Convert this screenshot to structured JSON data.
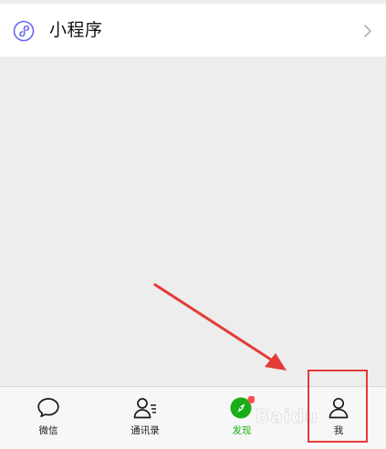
{
  "mini_programs": {
    "label": "小程序",
    "icon": "mini-program-icon",
    "chevron_icon": "chevron-right-icon"
  },
  "tab_bar": {
    "tabs": [
      {
        "label": "微信",
        "icon": "chat-bubble-icon",
        "active": false
      },
      {
        "label": "通讯录",
        "icon": "contacts-icon",
        "active": false
      },
      {
        "label": "发现",
        "icon": "compass-icon",
        "active": true,
        "badge_dot": true
      },
      {
        "label": "我",
        "icon": "person-icon",
        "active": false
      }
    ]
  },
  "annotation": {
    "arrow_color": "#e53b37",
    "box_color": "#e53b37"
  },
  "watermark": {
    "text": "Baidu"
  },
  "colors": {
    "accent_green": "#1aad19",
    "badge_red": "#fa5151",
    "background": "#ededed",
    "tab_bar_bg": "#f7f7f7"
  }
}
